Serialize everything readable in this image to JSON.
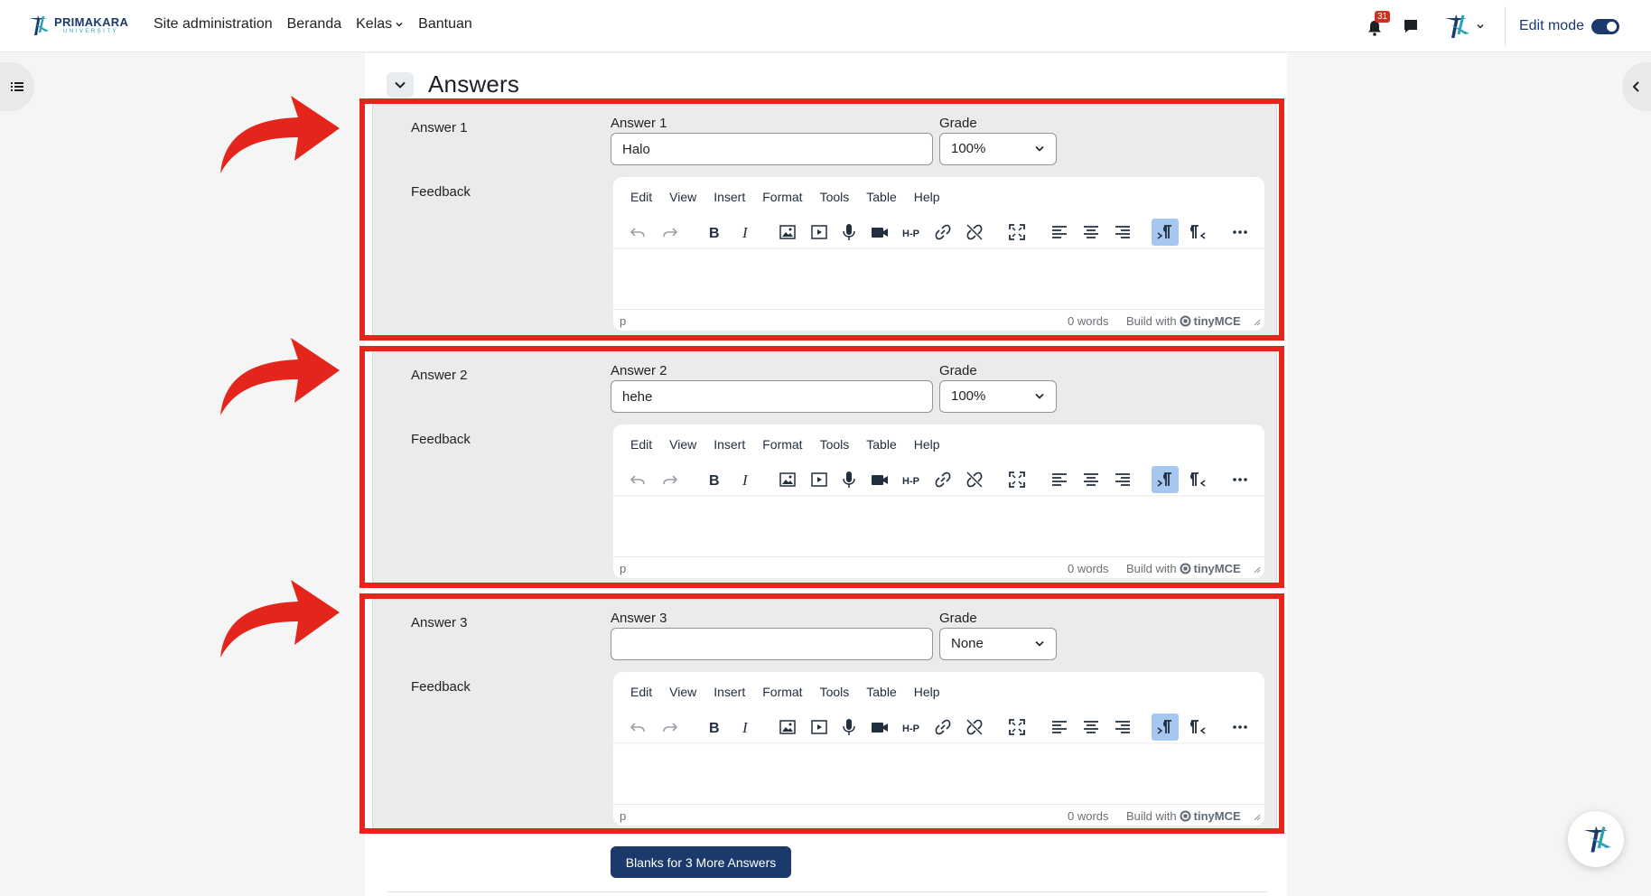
{
  "brand": {
    "name": "PRIMAKARA",
    "subtitle": "UNIVERSITY"
  },
  "nav": {
    "links": [
      "Site administration",
      "Beranda",
      "Kelas",
      "Bantuan"
    ],
    "notification_count": "31",
    "edit_mode_label": "Edit mode",
    "edit_mode_on": true
  },
  "section": {
    "title": "Answers"
  },
  "editor": {
    "menus": [
      "Edit",
      "View",
      "Insert",
      "Format",
      "Tools",
      "Table",
      "Help"
    ],
    "path": "p",
    "word_count": "0 words",
    "build_with": "Build with",
    "brand": "tinyMCE"
  },
  "answers": [
    {
      "label": "Answer 1",
      "field_label": "Answer 1",
      "value": "Halo",
      "grade_label": "Grade",
      "grade": "100%",
      "feedback_label": "Feedback"
    },
    {
      "label": "Answer 2",
      "field_label": "Answer 2",
      "value": "hehe",
      "grade_label": "Grade",
      "grade": "100%",
      "feedback_label": "Feedback"
    },
    {
      "label": "Answer 3",
      "field_label": "Answer 3",
      "value": "",
      "grade_label": "Grade",
      "grade": "None",
      "feedback_label": "Feedback"
    }
  ],
  "more_answers_button": "Blanks for 3 More Answers",
  "colors": {
    "brand": "#1b3a6b",
    "annotation": "#e4251c",
    "badge": "#ca3120"
  }
}
